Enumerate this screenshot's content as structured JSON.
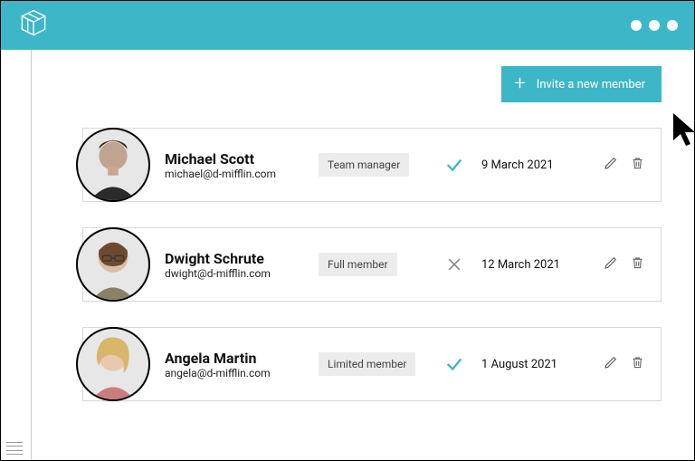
{
  "colors": {
    "accent": "#3db6c7"
  },
  "header": {
    "logo_name": "cube-logo"
  },
  "invite_button": {
    "label": "Invite a new member"
  },
  "members": [
    {
      "name": "Michael Scott",
      "email": "michael@d-mifflin.com",
      "role": "Team manager",
      "status": "check",
      "date": "9 March 2021"
    },
    {
      "name": "Dwight Schrute",
      "email": "dwight@d-mifflin.com",
      "role": "Full member",
      "status": "cross",
      "date": "12 March 2021"
    },
    {
      "name": "Angela Martin",
      "email": "angela@d-mifflin.com",
      "role": "Limited member",
      "status": "check",
      "date": "1 August 2021"
    }
  ]
}
